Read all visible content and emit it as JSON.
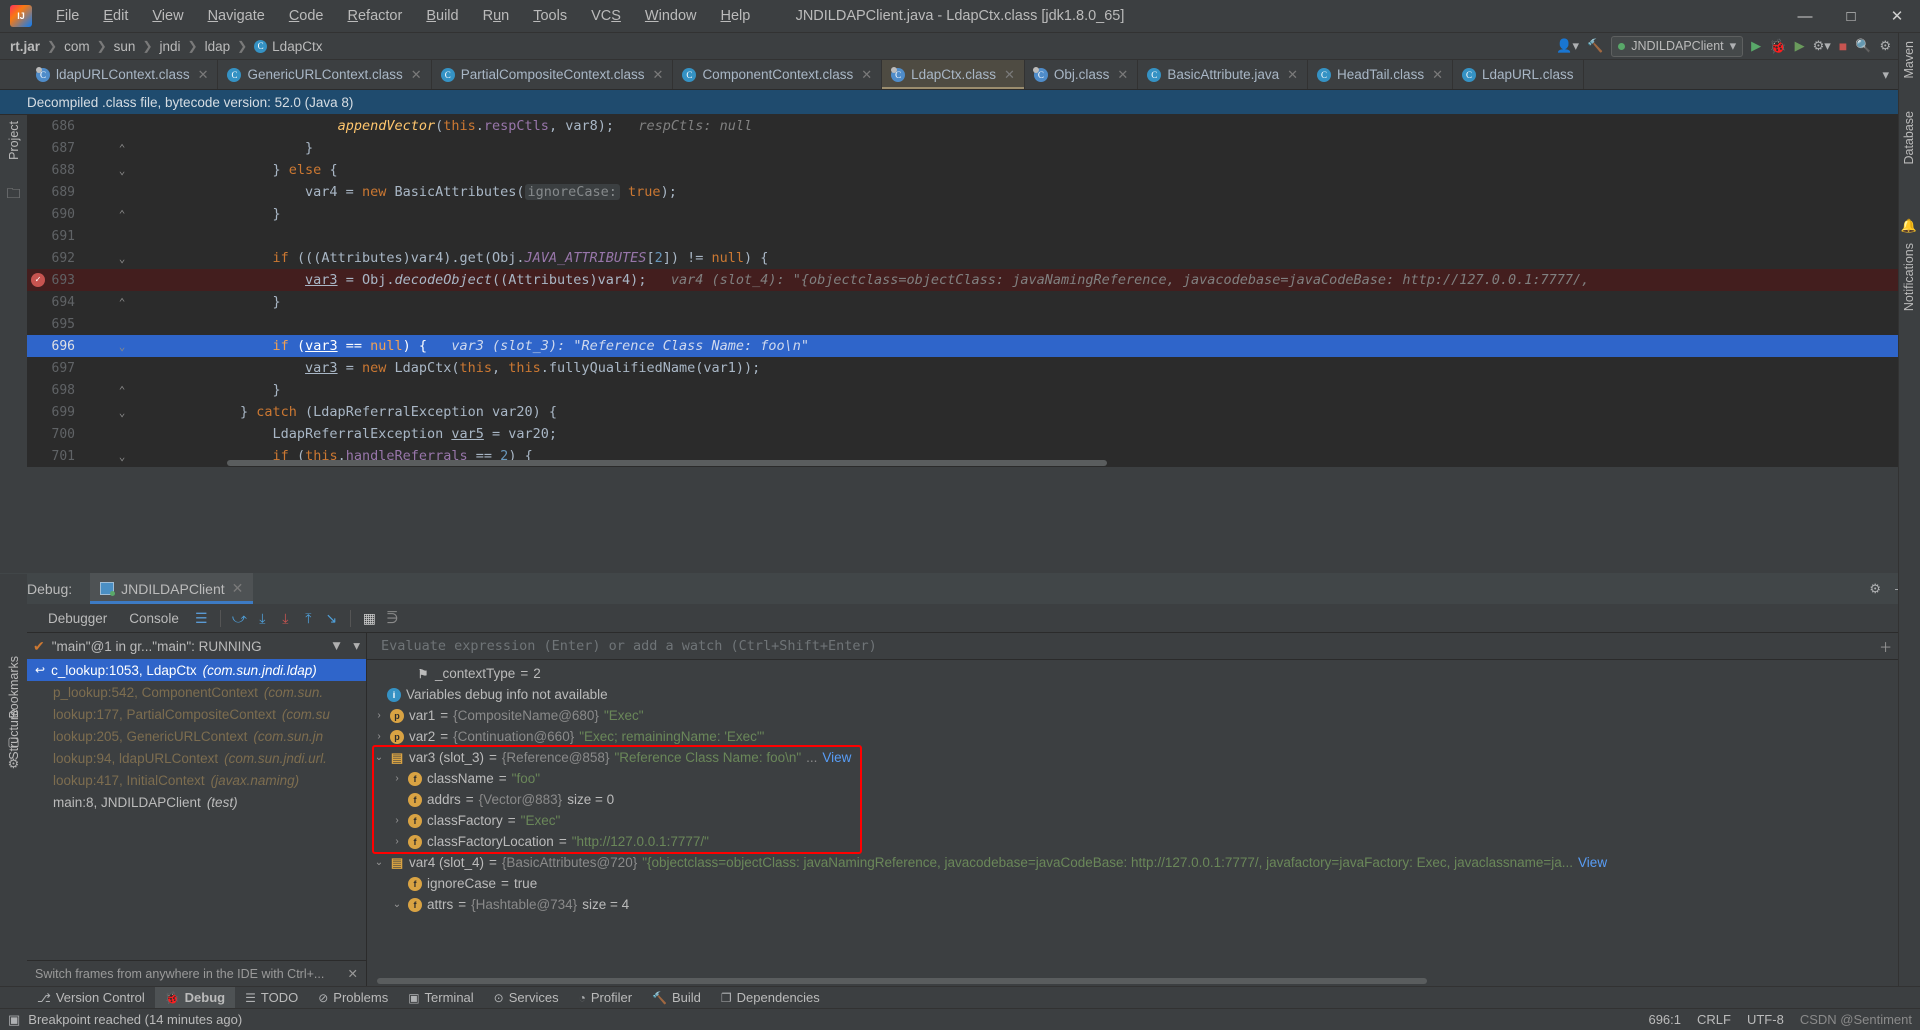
{
  "window": {
    "title": "JNDILDAPClient.java - LdapCtx.class [jdk1.8.0_65]",
    "minimize": "—",
    "maximize": "□",
    "close": "✕"
  },
  "menu": [
    {
      "label": "File"
    },
    {
      "label": "Edit"
    },
    {
      "label": "View"
    },
    {
      "label": "Navigate"
    },
    {
      "label": "Code"
    },
    {
      "label": "Refactor"
    },
    {
      "label": "Build"
    },
    {
      "label": "Run"
    },
    {
      "label": "Tools"
    },
    {
      "label": "VCS"
    },
    {
      "label": "Window"
    },
    {
      "label": "Help"
    }
  ],
  "breadcrumb": {
    "items": [
      "rt.jar",
      "com",
      "sun",
      "jndi",
      "ldap",
      "LdapCtx"
    ],
    "class_icon": "C"
  },
  "navbar_right": {
    "run_config": "JNDILDAPClient",
    "run_icon": "▶",
    "debug_icon": "🐞",
    "coverage_icon": "▶",
    "more_icon": "▾",
    "stop_icon": "■",
    "search_icon": "🔍",
    "settings_icon": "⚙",
    "updates_icon": "↻",
    "account_icon": "person-icon"
  },
  "tabs": [
    {
      "label": "ldapURLContext.class",
      "icon": "C",
      "active": false,
      "decompiled": true
    },
    {
      "label": "GenericURLContext.class",
      "icon": "C",
      "active": false,
      "decompiled": false
    },
    {
      "label": "PartialCompositeContext.class",
      "icon": "C",
      "active": false,
      "decompiled": false
    },
    {
      "label": "ComponentContext.class",
      "icon": "C",
      "active": false,
      "decompiled": false
    },
    {
      "label": "LdapCtx.class",
      "icon": "C",
      "active": true,
      "decompiled": true
    },
    {
      "label": "Obj.class",
      "icon": "C",
      "active": false,
      "decompiled": true
    },
    {
      "label": "BasicAttribute.java",
      "icon": "C",
      "active": false,
      "decompiled": false
    },
    {
      "label": "HeadTail.class",
      "icon": "C",
      "active": false,
      "decompiled": false
    },
    {
      "label": "LdapURL.class",
      "icon": "C",
      "active": false,
      "decompiled": false
    }
  ],
  "tabbar_right": {
    "chevron": "▾",
    "more": "⋮"
  },
  "notification": {
    "text": "Decompiled .class file, bytecode version: 52.0 (Java 8)"
  },
  "left_strip": {
    "project": "Project",
    "bookmarks": "Bookmarks",
    "structure": "Structure"
  },
  "right_strip": {
    "maven": "Maven",
    "database": "Database",
    "notifications": "Notifications"
  },
  "code": {
    "lines": [
      {
        "num": "686",
        "fold": "",
        "state": "normal",
        "html": "                    <span class=\"mth ital\">appendVector</span>(<span class=\"kw\">this</span>.<span class=\"fld\">respCtls</span>, var8);   <span class=\"hint\">respCtls: null</span>"
      },
      {
        "num": "687",
        "fold": "⌃",
        "state": "normal",
        "html": "                }"
      },
      {
        "num": "688",
        "fold": "⌄",
        "state": "normal",
        "html": "            } <span class=\"kw\">else</span> {"
      },
      {
        "num": "689",
        "fold": "",
        "state": "normal",
        "html": "                var4 = <span class=\"kw\">new</span> BasicAttributes(<span class=\"param-hint\">ignoreCase:</span> <span class=\"kw\">true</span>);"
      },
      {
        "num": "690",
        "fold": "⌃",
        "state": "normal",
        "html": "            }"
      },
      {
        "num": "691",
        "fold": "",
        "state": "normal",
        "html": ""
      },
      {
        "num": "692",
        "fold": "⌄",
        "state": "normal",
        "html": "            <span class=\"kw\">if</span> (((Attributes)var4).get(Obj.<span class=\"sfld\">JAVA_ATTRIBUTES</span>[<span class=\"num\">2</span>]) != <span class=\"kw\">null</span>) {"
      },
      {
        "num": "693",
        "fold": "",
        "state": "bp",
        "breakpoint": true,
        "html": "                <span class=\"uline\">var3</span> = Obj.<span class=\"ital\">decodeObject</span>((Attributes)var4);   <span class=\"hint\">var4 (slot_4): \"{objectclass=objectClass: javaNamingReference, javacodebase=javaCodeBase: http://127.0.0.1:7777/,</span>"
      },
      {
        "num": "694",
        "fold": "⌃",
        "state": "normal",
        "html": "            }"
      },
      {
        "num": "695",
        "fold": "",
        "state": "normal",
        "html": ""
      },
      {
        "num": "696",
        "fold": "⌄",
        "state": "cur",
        "html": "            <span class=\"kw\">if</span> (<span class=\"uline\">var3</span> == <span class=\"kw\">null</span>) {   <span class=\"hint\">var3 (slot_3): \"Reference Class Name: foo\\n\"</span>"
      },
      {
        "num": "697",
        "fold": "",
        "state": "normal",
        "html": "                <span class=\"uline\">var3</span> = <span class=\"kw\">new</span> LdapCtx(<span class=\"kw\">this</span>, <span class=\"kw\">this</span>.fullyQualifiedName(var1));"
      },
      {
        "num": "698",
        "fold": "⌃",
        "state": "normal",
        "html": "            }"
      },
      {
        "num": "699",
        "fold": "⌄",
        "state": "normal",
        "html": "        } <span class=\"kw\">catch</span> (LdapReferralException var20) {"
      },
      {
        "num": "700",
        "fold": "",
        "state": "normal",
        "html": "            LdapReferralException <span class=\"uline\">var5</span> = var20;"
      },
      {
        "num": "701",
        "fold": "⌄",
        "state": "normal",
        "html": "            <span class=\"kw\">if</span> (<span class=\"kw\">this</span>.<span class=\"fld\">handleReferrals</span> == <span class=\"num\">2</span>) {"
      }
    ]
  },
  "debug": {
    "label": "Debug:",
    "session_tab": "JNDILDAPClient",
    "close_icon": "✕",
    "settings_icon": "⚙",
    "minimize_icon": "—",
    "tabs": [
      {
        "label": "Debugger",
        "active": true
      },
      {
        "label": "Console",
        "active": false
      }
    ],
    "toolbar_icons": [
      {
        "name": "layout-icon",
        "glyph": "≡"
      },
      {
        "name": "step-over-icon",
        "glyph": "⤻"
      },
      {
        "name": "step-into-icon",
        "glyph": "↓"
      },
      {
        "name": "force-step-into-icon",
        "glyph": "↓"
      },
      {
        "name": "step-out-icon",
        "glyph": "↑"
      },
      {
        "name": "run-to-cursor-icon",
        "glyph": "↘"
      },
      {
        "name": "evaluate-expression-icon",
        "glyph": "▦"
      },
      {
        "name": "settings-icon",
        "glyph": "⋽"
      }
    ],
    "rail_icons": [
      {
        "name": "rerun-icon",
        "glyph": "↻"
      },
      {
        "name": "settings-wrench-icon",
        "glyph": "🔧"
      },
      {
        "name": "resume-icon",
        "glyph": "▶"
      },
      {
        "name": "pause-icon",
        "glyph": "❙❙"
      },
      {
        "name": "stop-icon",
        "glyph": "■"
      },
      {
        "name": "view-breakpoints-icon",
        "glyph": "●"
      },
      {
        "name": "mute-breakpoints-icon",
        "glyph": "◈"
      }
    ],
    "thread": {
      "label": "\"main\"@1 in gr...\"main\": RUNNING",
      "check": "✔",
      "filter_icon": "▼",
      "dropdown_icon": "▾"
    },
    "frames": [
      {
        "label": "c_lookup:1053, LdapCtx",
        "pkg": "(com.sun.jndi.ldap)",
        "style": "sel"
      },
      {
        "label": "p_lookup:542, ComponentContext",
        "pkg": "(com.sun.",
        "style": "lib"
      },
      {
        "label": "lookup:177, PartialCompositeContext",
        "pkg": "(com.su",
        "style": "lib"
      },
      {
        "label": "lookup:205, GenericURLContext",
        "pkg": "(com.sun.jn",
        "style": "lib"
      },
      {
        "label": "lookup:94, ldapURLContext",
        "pkg": "(com.sun.jndi.url.",
        "style": "lib"
      },
      {
        "label": "lookup:417, InitialContext",
        "pkg": "(javax.naming)",
        "style": "lib"
      },
      {
        "label": "main:8, JNDILDAPClient",
        "pkg": "(test)",
        "style": "user"
      }
    ],
    "frames_hint": {
      "text": "Switch frames from anywhere in the IDE with Ctrl+...",
      "close": "✕"
    },
    "evaluate_placeholder": "Evaluate expression (Enter) or add a watch (Ctrl+Shift+Enter)",
    "eval_right_icons": [
      {
        "glyph": "+"
      },
      {
        "glyph": "▾"
      }
    ],
    "variables": [
      {
        "indent": 1,
        "arrow": "",
        "icon": "flag",
        "icon_glyph": "⚐",
        "name": "_contextType",
        "eq": " = ",
        "value": "2",
        "value_class": "vnum",
        "highlight": false
      },
      {
        "indent": 0,
        "arrow": "",
        "icon": "info",
        "icon_glyph": "i",
        "name": "Variables debug info not available",
        "eq": "",
        "value": "",
        "value_class": "vname",
        "highlight": false
      },
      {
        "indent": 0,
        "arrow": "›",
        "icon": "p",
        "icon_glyph": "p",
        "name": "var1",
        "eq": " = ",
        "value": "{CompositeName@680} \"Exec\"",
        "value_class": "mixed",
        "highlight": false,
        "type_part": "{CompositeName@680}",
        "str_part": "\"Exec\""
      },
      {
        "indent": 0,
        "arrow": "›",
        "icon": "p",
        "icon_glyph": "p",
        "name": "var2",
        "eq": " = ",
        "value": "{Continuation@660} \"Exec; remainingName: 'Exec'\"",
        "value_class": "mixed",
        "highlight": false,
        "type_part": "{Continuation@660}",
        "str_part": "\"Exec; remainingName: 'Exec'\""
      },
      {
        "indent": 0,
        "arrow": "⌄",
        "icon": "obj",
        "icon_glyph": "▤",
        "name": "var3 (slot_3)",
        "eq": " = ",
        "type_part": "{Reference@858}",
        "str_part": "\"Reference Class Name: foo\\n\"",
        "suffix": " ... ",
        "link": "View",
        "highlight": true
      },
      {
        "indent": 1,
        "arrow": "›",
        "icon": "f",
        "icon_glyph": "f",
        "name": "className",
        "eq": " = ",
        "str_part": "\"foo\"",
        "highlight": true
      },
      {
        "indent": 1,
        "arrow": "",
        "icon": "f",
        "icon_glyph": "f",
        "name": "addrs",
        "eq": " = ",
        "type_part": "{Vector@883}",
        "suffix2": "  size = 0",
        "highlight": true
      },
      {
        "indent": 1,
        "arrow": "›",
        "icon": "f",
        "icon_glyph": "f",
        "name": "classFactory",
        "eq": " = ",
        "str_part": "\"Exec\"",
        "highlight": true
      },
      {
        "indent": 1,
        "arrow": "›",
        "icon": "f",
        "icon_glyph": "f",
        "name": "classFactoryLocation",
        "eq": " = ",
        "str_part": "\"http://127.0.0.1:7777/\"",
        "highlight": true
      },
      {
        "indent": 0,
        "arrow": "⌄",
        "icon": "obj",
        "icon_glyph": "▤",
        "name": "var4 (slot_4)",
        "eq": " = ",
        "type_part": "{BasicAttributes@720}",
        "str_part": "\"{objectclass=objectClass: javaNamingReference, javacodebase=javaCodeBase: http://127.0.0.1:7777/, javafactory=javaFactory: Exec, javaclassname=ja...",
        "suffix": " ",
        "link": "View",
        "highlight": false
      },
      {
        "indent": 1,
        "arrow": "",
        "icon": "f",
        "icon_glyph": "f",
        "name": "ignoreCase",
        "eq": " = ",
        "value": "true",
        "value_class": "vnum",
        "highlight": false
      },
      {
        "indent": 1,
        "arrow": "⌄",
        "icon": "f",
        "icon_glyph": "f",
        "name": "attrs",
        "eq": " = ",
        "type_part": "{Hashtable@734}",
        "suffix2": "  size = 4",
        "highlight": false
      }
    ]
  },
  "tool_windows": [
    {
      "label": "Version Control",
      "icon": "⎇",
      "active": false
    },
    {
      "label": "Debug",
      "icon": "🐞",
      "active": true
    },
    {
      "label": "TODO",
      "icon": "☰",
      "active": false
    },
    {
      "label": "Problems",
      "icon": "⊘",
      "active": false
    },
    {
      "label": "Terminal",
      "icon": "▣",
      "active": false
    },
    {
      "label": "Services",
      "icon": "⊙",
      "active": false
    },
    {
      "label": "Profiler",
      "icon": "◔",
      "active": false
    },
    {
      "label": "Build",
      "icon": "🔨",
      "active": false
    },
    {
      "label": "Dependencies",
      "icon": "❐",
      "active": false
    }
  ],
  "statusbar": {
    "icon": "▣",
    "message": "Breakpoint reached (14 minutes ago)",
    "caret": "696:1",
    "line_sep": "CRLF",
    "encoding": "UTF-8",
    "watermark": "CSDN @Sentiment"
  },
  "colors": {
    "accent_blue": "#2f65ca",
    "breakpoint_red": "#c75450",
    "highlight_box_red": "#ff0000",
    "notification_blue": "#1f4b6e",
    "tab_active": "#4e4b42",
    "editor_bg": "#2b2b2b",
    "chrome_bg": "#3c3f41"
  }
}
